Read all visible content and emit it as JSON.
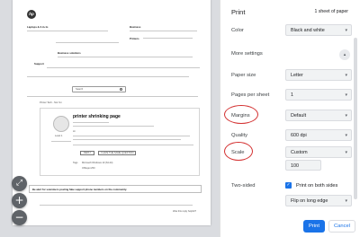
{
  "preview": {
    "logo": "hp",
    "header_labels": [
      "Laptops & 2-in-1s",
      "Business",
      "Printers",
      "Business solutions",
      "Support"
    ],
    "search_placeholder": "Search",
    "tabs_text": "Printer Tech - Not Yet",
    "page_heading": "printer shrinking page",
    "question_prefix": "Hi",
    "post_buttons": [
      "REPLY",
      "I HAVE THE SAME QUESTION"
    ],
    "tags": [
      "Tags",
      "Microsoft Windows 10 (64-bit)",
      "Officejet 250"
    ],
    "user_rank": "Level 1",
    "banner_text": "Be alert for scammers posting fake support phone numbers on the community.",
    "footer_text": "Was this reply helpful?",
    "zoom_fit": "⤢",
    "zoom_in": "+",
    "zoom_out": "−"
  },
  "panel": {
    "title": "Print",
    "sheet_count": "1 sheet of paper",
    "color": {
      "label": "Color",
      "value": "Black and white"
    },
    "more_settings": "More settings",
    "paper_size": {
      "label": "Paper size",
      "value": "Letter"
    },
    "pages_per_sheet": {
      "label": "Pages per sheet",
      "value": "1"
    },
    "margins": {
      "label": "Margins",
      "value": "Default"
    },
    "quality": {
      "label": "Quality",
      "value": "600 dpi"
    },
    "scale": {
      "label": "Scale",
      "value": "Custom",
      "custom_value": "100"
    },
    "two_sided": {
      "label": "Two-sided",
      "option": "Print on both sides",
      "flip_value": "Flip on long edge",
      "checked": true
    },
    "buttons": {
      "print": "Print",
      "cancel": "Cancel"
    },
    "chevron_down": "▾",
    "chevron_up": "▴",
    "checkmark": "✓"
  },
  "colors": {
    "accent": "#1a73e8",
    "annotation_ring": "#d32f2f",
    "preview_bg": "#dadce0"
  }
}
